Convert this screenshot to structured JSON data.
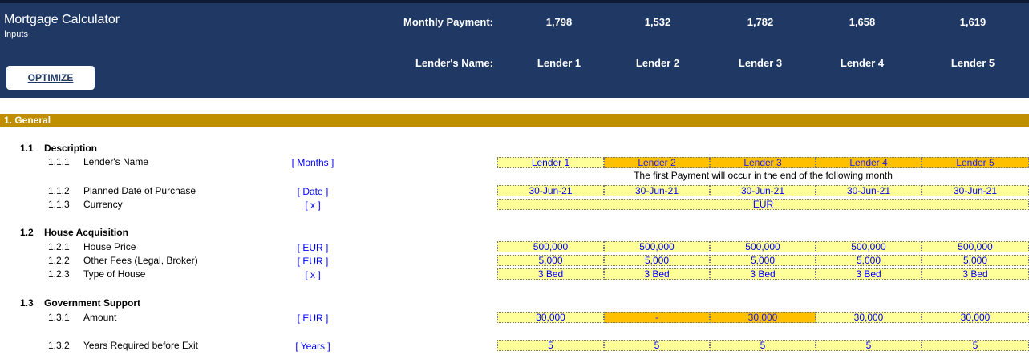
{
  "header": {
    "title": "Mortgage Calculator",
    "subtitle": "Inputs",
    "optimize_label": "OPTIMIZE",
    "monthly_payment_label": "Monthly Payment:",
    "monthly_payments": [
      "1,798",
      "1,532",
      "1,782",
      "1,658",
      "1,619"
    ],
    "lenders_name_label": "Lender's Name:",
    "lender_names": [
      "Lender 1",
      "Lender 2",
      "Lender 3",
      "Lender 4",
      "Lender 5"
    ]
  },
  "section": {
    "title": "1. General"
  },
  "subsections": [
    {
      "num": "1.1",
      "title": "Description"
    },
    {
      "num": "1.2",
      "title": "House Acquisition"
    },
    {
      "num": "1.3",
      "title": "Government Support"
    }
  ],
  "rows": {
    "lenders_name": {
      "num": "1.1.1",
      "label": "Lender's Name",
      "unit": "[ Months ]",
      "values": [
        "Lender 1",
        "Lender 2",
        "Lender 3",
        "Lender 4",
        "Lender 5"
      ]
    },
    "note": "The first Payment will occur in the end of the following month",
    "planned_date": {
      "num": "1.1.2",
      "label": "Planned Date of Purchase",
      "unit": "[ Date ]",
      "values": [
        "30-Jun-21",
        "30-Jun-21",
        "30-Jun-21",
        "30-Jun-21",
        "30-Jun-21"
      ]
    },
    "currency": {
      "num": "1.1.3",
      "label": "Currency",
      "unit": "[ x ]",
      "value": "EUR"
    },
    "house_price": {
      "num": "1.2.1",
      "label": "House Price",
      "unit": "[ EUR ]",
      "values": [
        "500,000",
        "500,000",
        "500,000",
        "500,000",
        "500,000"
      ]
    },
    "other_fees": {
      "num": "1.2.2",
      "label": "Other Fees (Legal, Broker)",
      "unit": "[ EUR ]",
      "values": [
        "5,000",
        "5,000",
        "5,000",
        "5,000",
        "5,000"
      ]
    },
    "type_of_house": {
      "num": "1.2.3",
      "label": "Type of House",
      "unit": "[ x ]",
      "values": [
        "3 Bed",
        "3 Bed",
        "3 Bed",
        "3 Bed",
        "3 Bed"
      ]
    },
    "amount": {
      "num": "1.3.1",
      "label": "Amount",
      "unit": "[ EUR ]",
      "values": [
        "30,000",
        "-",
        "30,000",
        "30,000",
        "30,000"
      ]
    },
    "years_required": {
      "num": "1.3.2",
      "label": "Years Required before Exit",
      "unit": "[ Years ]",
      "values": [
        "5",
        "5",
        "5",
        "5",
        "5"
      ]
    }
  },
  "colors": {
    "header_bg": "#1f3864",
    "section_bg": "#bf8f00",
    "input_cell": "#ffff99",
    "highlight_cell": "#ffc000",
    "input_text": "#0000ff"
  }
}
